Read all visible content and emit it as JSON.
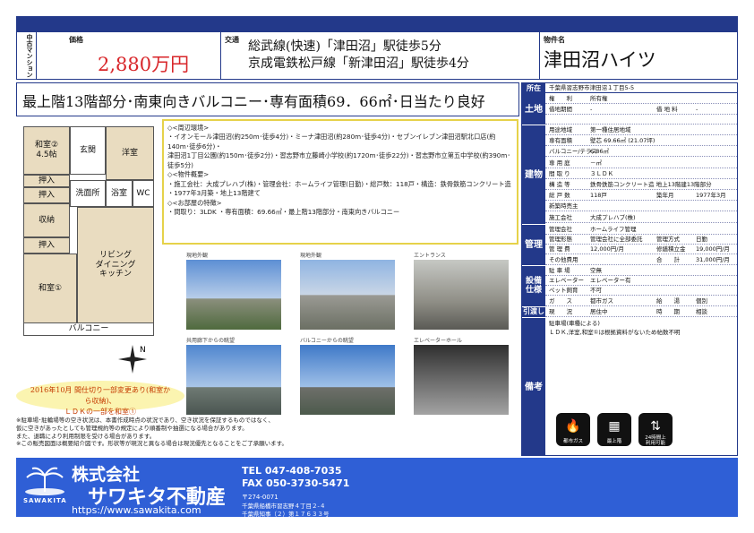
{
  "header": {
    "category_label": "中古マンション",
    "price_label": "価格",
    "price": "2,880万円",
    "transport_label": "交通",
    "transport_line1": "総武線(快速)「津田沼」駅徒歩5分",
    "transport_line2": "京成電鉄松戸線「新津田沼」駅徒歩4分",
    "property_label": "物件名",
    "property_name": "津田沼ハイツ"
  },
  "feature_line": "最上階13階部分･南東向きバルコニー･専有面積69．66㎡･日当たり良好",
  "floor_plan": {
    "rooms": {
      "washitsu2": "和室②\n4.5帖",
      "yoshitsu": "洋室",
      "genkan": "玄関",
      "oshiire1": "押入",
      "oshiire2": "押入",
      "shuno": "収納",
      "oshiire3": "押入",
      "washitsu1": "和室①",
      "ldk": "リビング\nダイニング\nキッチン",
      "bath": "浴室",
      "wc": "WC",
      "senmen": "洗面所",
      "balcony": "バルコニー"
    },
    "compass": "N"
  },
  "info_box": {
    "line1": "◇<周辺環境>",
    "line2": "・イオンモール津田沼(約250m･徒歩4分)・ミーナ津田沼(約280m･徒歩4分)・セブンイレブン津田沼駅北口店(約140m･徒歩6分)・",
    "line3": "津田沼1丁目公園(約150m･徒歩2分)・習志野市立藤崎小学校(約1720m･徒歩22分)・習志野市立第五中学校(約390m･徒歩5分)",
    "line4": "◇<物件概要>",
    "line5": "・施工会社：大成プレハブ(株)・管理会社：ホームライフ管理(日勤)・総戸数：118戸・構造：鉄骨鉄筋コンクリート造",
    "line6": "・1977年3月築・地上13階建て",
    "line7": "◇<お部屋の特徴>",
    "line8": "・間取り：3LDK ・専有面積：69.66㎡・最上階13階部分・南東向きバルコニー"
  },
  "photos": [
    {
      "caption": "現地外観"
    },
    {
      "caption": "現地外観"
    },
    {
      "caption": "エントランス"
    },
    {
      "caption": "共用廊下からの眺望"
    },
    {
      "caption": "バルコニーからの眺望"
    },
    {
      "caption": "エレベーターホール"
    }
  ],
  "remark": {
    "line1": "2016年10月 間仕切り一部変更あり(和室から収納)、",
    "line2": "ＬＤＫの一部を和室①"
  },
  "notes": {
    "line1": "※駐車場･駐輪場等の空き状況は、本書作成時点の状況であり、空き状況を保証するものではなく、",
    "line2": "仮に空きがあったとしても管理規約等の規定により順番制や抽選になる場合があります。",
    "line3": "また、退職により利用制限を受ける場合があります。",
    "line4": "※この販売図面は概要紹介図です。形状等が現況と異なる場合は現況優先となることをご了承願います。"
  },
  "spec": {
    "location_label": "所在",
    "location": "千葉県習志野市津田沼１丁目5-5",
    "land_label": "土地",
    "land_rows": [
      [
        "権　　利",
        "所有権",
        "",
        ""
      ],
      [
        "借地期間",
        "-",
        "借 地 料",
        "-"
      ],
      [
        "",
        "",
        "",
        ""
      ]
    ],
    "bldg_label": "建物",
    "bldg_rows": [
      [
        "用途地域",
        "第一種住居地域",
        "",
        ""
      ],
      [
        "専有面積",
        "壁芯 69.66㎡ (21.07坪)",
        "",
        ""
      ],
      [
        "バルコニー/テラス",
        "6.86㎡",
        "",
        ""
      ],
      [
        "専 用 庭",
        "－㎡",
        "",
        ""
      ],
      [
        "間 取 り",
        "３ＬＤＫ",
        "",
        ""
      ],
      [
        "構 造 等",
        "鉄骨鉄筋コンクリート造 地上13階建13階部分",
        "",
        ""
      ],
      [
        "総 戸 数",
        "118戸",
        "築年月",
        "1977年3月"
      ],
      [
        "新築時売主",
        "",
        "",
        ""
      ],
      [
        "施工会社",
        "大成プレハブ(株)",
        "",
        ""
      ]
    ],
    "mgmt_label": "管理",
    "mgmt_rows": [
      [
        "管理会社",
        "ホームライフ管理",
        "",
        ""
      ],
      [
        "管理形態",
        "管理会社に全部委託",
        "管理方式",
        "日勤"
      ],
      [
        "管 理 費",
        "12,000円/月",
        "修繕積立金",
        "19,000円/月"
      ],
      [
        "その他費用",
        "",
        "合　　計",
        "31,000円/月"
      ]
    ],
    "equip_label": "設備\n仕様",
    "equip_rows": [
      [
        "駐 車 場",
        "空無",
        "",
        ""
      ],
      [
        "エレベーター",
        "エレベーター有",
        "",
        ""
      ],
      [
        "ペット飼育",
        "不可",
        "",
        ""
      ],
      [
        "ガ　　ス",
        "都市ガス",
        "給　　湯",
        "個別"
      ]
    ],
    "handover_label": "引渡し",
    "handover_rows": [
      [
        "現　　況",
        "居住中",
        "時　　期",
        "相談"
      ]
    ],
    "remarks_label": "備考",
    "remarks_line1": "駐車場(車種による)",
    "remarks_line2": "ＬＤＫ,洋室,和室①は根拠資料がないため帖数不明",
    "icons": [
      {
        "name": "city-gas-icon",
        "label": "都市ガス",
        "glyph": "🔥"
      },
      {
        "name": "top-floor-icon",
        "label": "最上階",
        "glyph": "▦"
      },
      {
        "name": "elevator-icon",
        "label": "24時間上\n利用可能",
        "glyph": "⇅"
      }
    ]
  },
  "footer": {
    "company_line1": "株式会社",
    "company_line2": "サワキタ不動産",
    "logo_text": "SAWAKITA",
    "url": "https://www.sawakita.com",
    "tel": "TEL 047-408-7035",
    "fax": "FAX 050-3730-5471",
    "postal": "〒274-0071",
    "address1": "千葉県船橋市習志野４丁目２-４",
    "address2": "千葉県知事（２）第１７６３３号"
  },
  "colors": {
    "navy": "#23398a",
    "footer_blue": "#2f5fd6",
    "price_red": "#d8262a",
    "accent_yellow": "#e6d24a"
  }
}
